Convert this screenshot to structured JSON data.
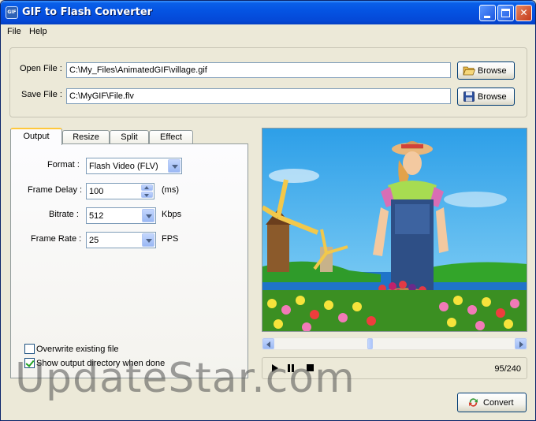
{
  "window": {
    "icon_text": "GIF",
    "title": "GIF to Flash Converter"
  },
  "menu": [
    "File",
    "Help"
  ],
  "files": {
    "open_label": "Open File :",
    "open_value": "C:\\My_Files\\AnimatedGIF\\village.gif",
    "save_label": "Save File :",
    "save_value": "C:\\MyGIF\\File.flv",
    "browse_label": "Browse"
  },
  "tabs": [
    "Output",
    "Resize",
    "Split",
    "Effect"
  ],
  "output": {
    "format_label": "Format :",
    "format_value": "Flash Video (FLV)",
    "delay_label": "Frame Delay :",
    "delay_value": "100",
    "delay_unit": "(ms)",
    "bitrate_label": "Bitrate :",
    "bitrate_value": "512",
    "bitrate_unit": "Kbps",
    "framerate_label": "Frame Rate :",
    "framerate_value": "25",
    "framerate_unit": "FPS"
  },
  "options": {
    "overwrite_label": "Overwrite existing file",
    "overwrite_checked": false,
    "show_dir_label": "Show output directory when done",
    "show_dir_checked": true
  },
  "player": {
    "current_frame": 95,
    "total_frames": 240,
    "counter": "95/240"
  },
  "convert_label": "Convert",
  "watermark": "UpdateStar.com",
  "colors": {
    "titlebar": "#0554e3",
    "window_bg": "#ece9d8",
    "sky": "#49b4ee",
    "grass": "#3ba320"
  }
}
